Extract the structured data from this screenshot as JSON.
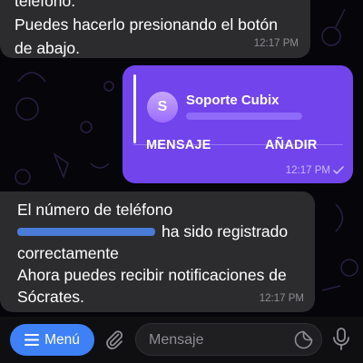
{
  "messages": {
    "msg1": {
      "line_top": "teléfono.",
      "line_a": "Puedes hacerlo presionando el botón",
      "line_b": "de abajo.",
      "time": "12:17 PM"
    },
    "contact": {
      "avatar_letter": "S",
      "name": "Soporte Cubix",
      "action_message": "MENSAJE",
      "action_add": "AÑADIR",
      "time": "12:17 PM"
    },
    "msg2": {
      "line1": "El número de teléfono",
      "line2": "ha sido registrado",
      "line3": "correctamente",
      "line4": "Ahora puedes recibir notificaciones de",
      "line5": "Sócrates.",
      "time": "12:17 PM"
    }
  },
  "input_bar": {
    "menu_label": "Menú",
    "placeholder": "Mensaje"
  },
  "colors": {
    "accent": "#3e80f5",
    "outgoing_bubble": "#7244ec",
    "incoming_bubble": "#2c2c2e",
    "background": "#06050a"
  },
  "icons": {
    "menu": "hamburger-icon",
    "attach": "paperclip-icon",
    "sticker": "sticker-icon",
    "mic": "microphone-icon",
    "read": "checkmark-icon"
  }
}
